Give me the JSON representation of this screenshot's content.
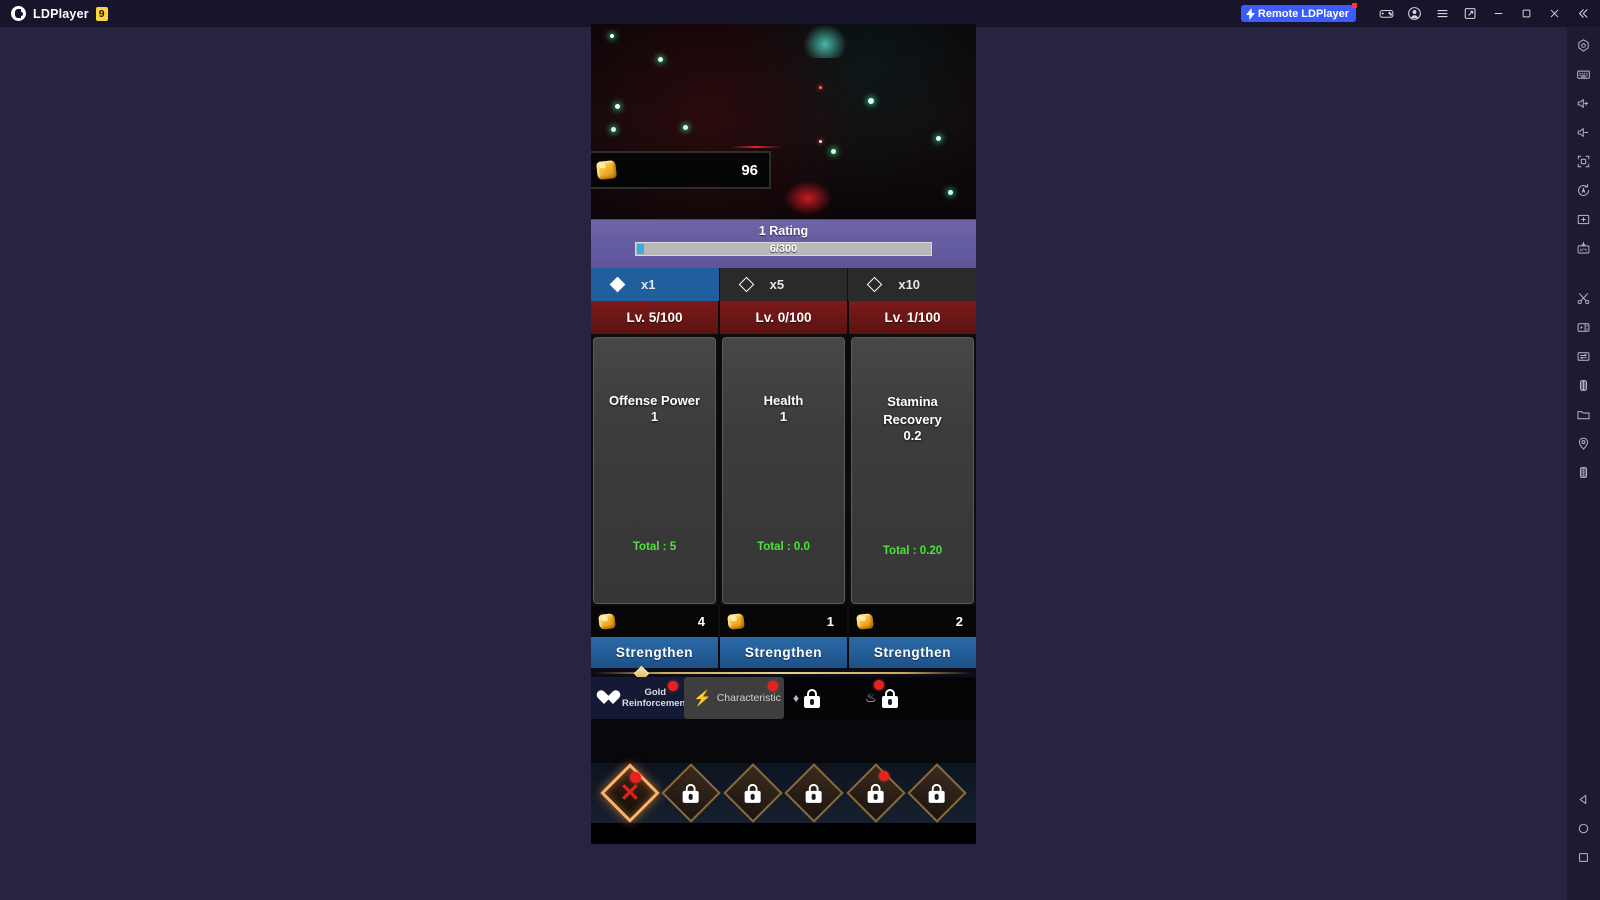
{
  "titlebar": {
    "app_name": "LDPlayer",
    "version_badge": "9",
    "remote_button": "Remote LDPlayer",
    "icons": [
      "gamepad-icon",
      "account-icon",
      "menu-icon",
      "multi-instance-icon",
      "minimize-icon",
      "maximize-icon",
      "close-icon",
      "collapse-icon"
    ]
  },
  "sidebar": {
    "top_icons": [
      "fullscreen-hex-icon",
      "keyboard-icon",
      "volume-up-icon",
      "volume-down-icon",
      "resize-icon",
      "auto-rotate-icon",
      "screenshot-icon",
      "apk-install-icon",
      "scissors-icon",
      "video-record-icon",
      "sync-icon",
      "shake-icon",
      "folder-icon",
      "location-icon",
      "virtual-phone-icon"
    ],
    "bottom_icons": [
      "back-icon",
      "home-icon",
      "recents-icon"
    ]
  },
  "game": {
    "hud": {
      "gold_icon": "gold-nugget-icon",
      "gold_amount": "96"
    },
    "rating": {
      "title": "1 Rating",
      "progress_text": "6/300",
      "current": 6,
      "max": 300,
      "fill_color": "#3aa9e8"
    },
    "multipliers": [
      {
        "label": "x1",
        "selected": true
      },
      {
        "label": "x5",
        "selected": false
      },
      {
        "label": "x10",
        "selected": false
      }
    ],
    "stats": [
      {
        "level": "Lv. 5/100",
        "name": "Offense Power",
        "value": "1",
        "total": "Total : 5",
        "cost": "4",
        "button": "Strengthen"
      },
      {
        "level": "Lv. 0/100",
        "name": "Health",
        "value": "1",
        "total": "Total : 0.0",
        "cost": "1",
        "button": "Strengthen"
      },
      {
        "level": "Lv. 1/100",
        "name": "Stamina Recovery",
        "value": "0.2",
        "total": "Total : 0.20",
        "cost": "2",
        "button": "Strengthen"
      }
    ],
    "tabs": [
      {
        "label": "Gold Reinforcement",
        "icon": "heart-icon",
        "badge": true,
        "locked": false,
        "selected": false
      },
      {
        "label": "Characteristic",
        "icon": "bolt-icon",
        "badge": true,
        "locked": false,
        "selected": true
      },
      {
        "label": "",
        "icon": "diamond-icon",
        "badge": false,
        "locked": true,
        "selected": false
      },
      {
        "label": "",
        "icon": "flame-icon",
        "badge": true,
        "locked": true,
        "selected": false
      }
    ],
    "slots": [
      {
        "icon": "x-mark-icon",
        "locked": false,
        "badge": true,
        "active": true
      },
      {
        "icon": "lock-icon",
        "locked": true,
        "badge": false,
        "active": false
      },
      {
        "icon": "lock-icon",
        "locked": true,
        "badge": false,
        "active": false
      },
      {
        "icon": "lock-icon",
        "locked": true,
        "badge": false,
        "active": false
      },
      {
        "icon": "lock-icon",
        "locked": true,
        "badge": true,
        "active": false
      },
      {
        "icon": "lock-icon",
        "locked": true,
        "badge": false,
        "active": false
      }
    ]
  },
  "colors": {
    "accent_blue": "#3b5bfd",
    "level_red": "#5c1212",
    "strengthen_blue": "#1d5186",
    "total_green": "#4ee23c",
    "rating_purple": "#6e65a8",
    "badge_red": "#e8231f"
  }
}
